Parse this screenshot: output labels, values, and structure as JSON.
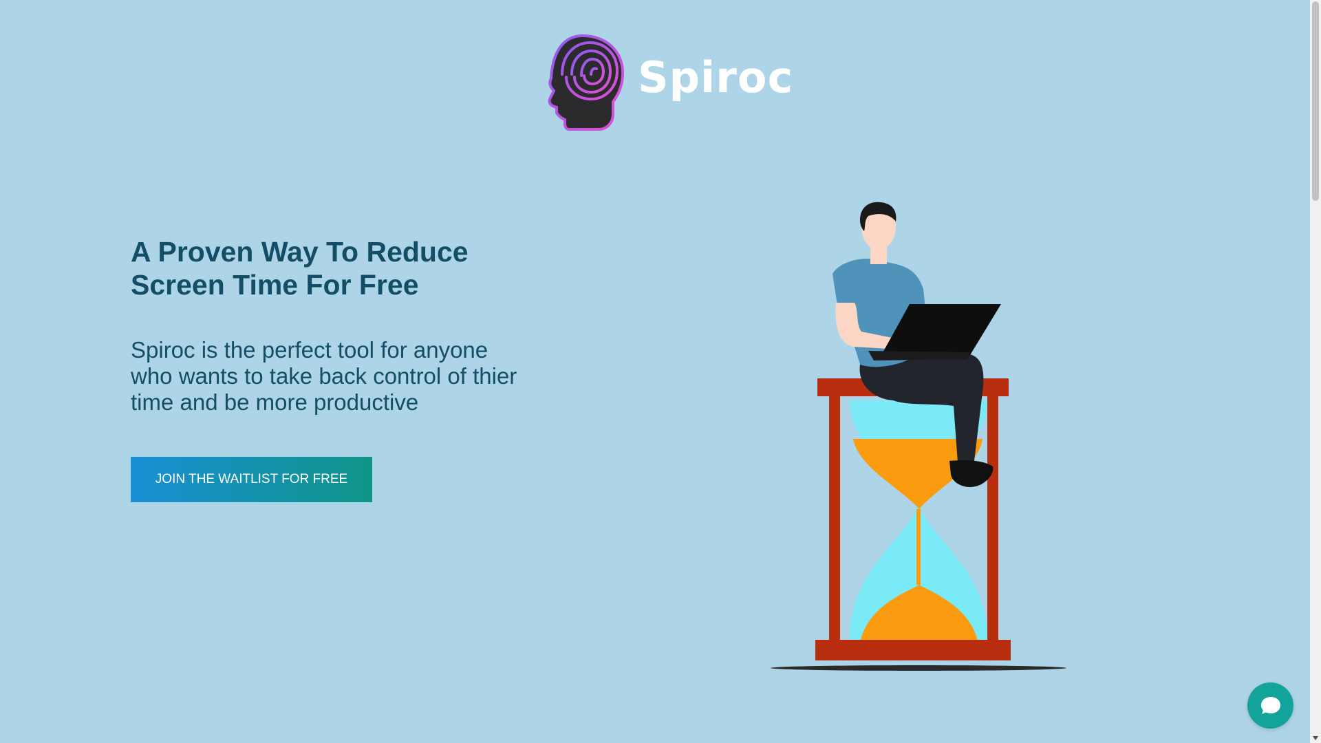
{
  "brand": {
    "name": "Spiroc"
  },
  "hero": {
    "title": "A Proven Way To Reduce Screen Time For Free",
    "description": "Spiroc is the perfect tool for anyone who wants to take back control of thier time and be more productive",
    "cta_label": "JOIN THE WAITLIST FOR FREE"
  },
  "colors": {
    "background": "#aed4e7",
    "heading": "#134e66",
    "cta_start": "#1b8fd6",
    "cta_end": "#0f9488",
    "chat_widget": "#12a39a"
  },
  "icons": {
    "logo": "brain-head-icon",
    "chat": "chat-bubble-icon"
  }
}
